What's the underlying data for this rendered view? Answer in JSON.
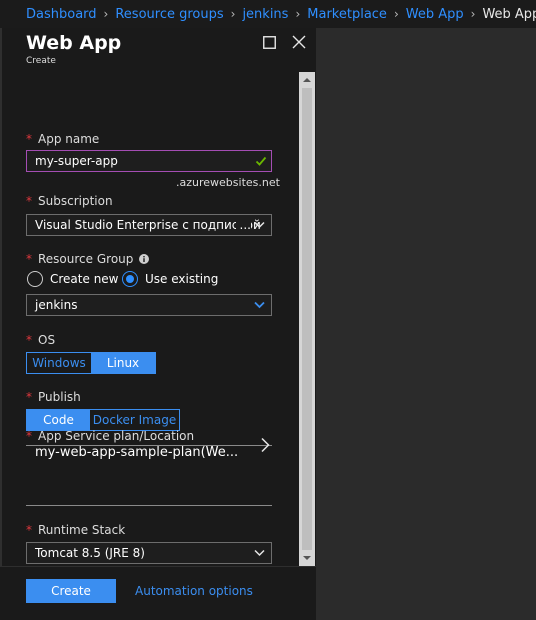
{
  "breadcrumb": {
    "items": [
      "Dashboard",
      "Resource groups",
      "jenkins",
      "Marketplace",
      "Web App"
    ],
    "current": "Web App",
    "separator": "›"
  },
  "blade": {
    "title": "Web App",
    "subtitle": "Create",
    "icons": [
      "maximize-icon",
      "close-icon"
    ]
  },
  "form": {
    "app_name": {
      "label": "App name",
      "value": "my-super-app",
      "suffix": ".azurewebsites.net",
      "valid": true
    },
    "subscription": {
      "label": "Subscription",
      "value": "Visual Studio Enterprise с подпиской",
      "ellipsis": "..."
    },
    "resource_group": {
      "label": "Resource Group",
      "options": [
        "Create new",
        "Use existing"
      ],
      "selected": "Use existing",
      "value": "jenkins"
    },
    "os": {
      "label": "OS",
      "options": [
        "Windows",
        "Linux"
      ],
      "selected": "Linux"
    },
    "publish": {
      "label": "Publish",
      "options": [
        "Code",
        "Docker Image"
      ],
      "selected": "Code"
    },
    "app_service_plan": {
      "label": "App Service plan/Location",
      "value": "my-web-app-sample-plan(We..."
    },
    "runtime_stack": {
      "label": "Runtime Stack",
      "value": "Tomcat 8.5 (JRE 8)"
    }
  },
  "footer": {
    "create_label": "Create",
    "automation_label": "Automation options"
  },
  "colors": {
    "accent": "#3b8ef0",
    "link": "#2f8fff",
    "required": "#e0383e",
    "valid": "#6bb700",
    "focus_border": "#a44db3"
  }
}
